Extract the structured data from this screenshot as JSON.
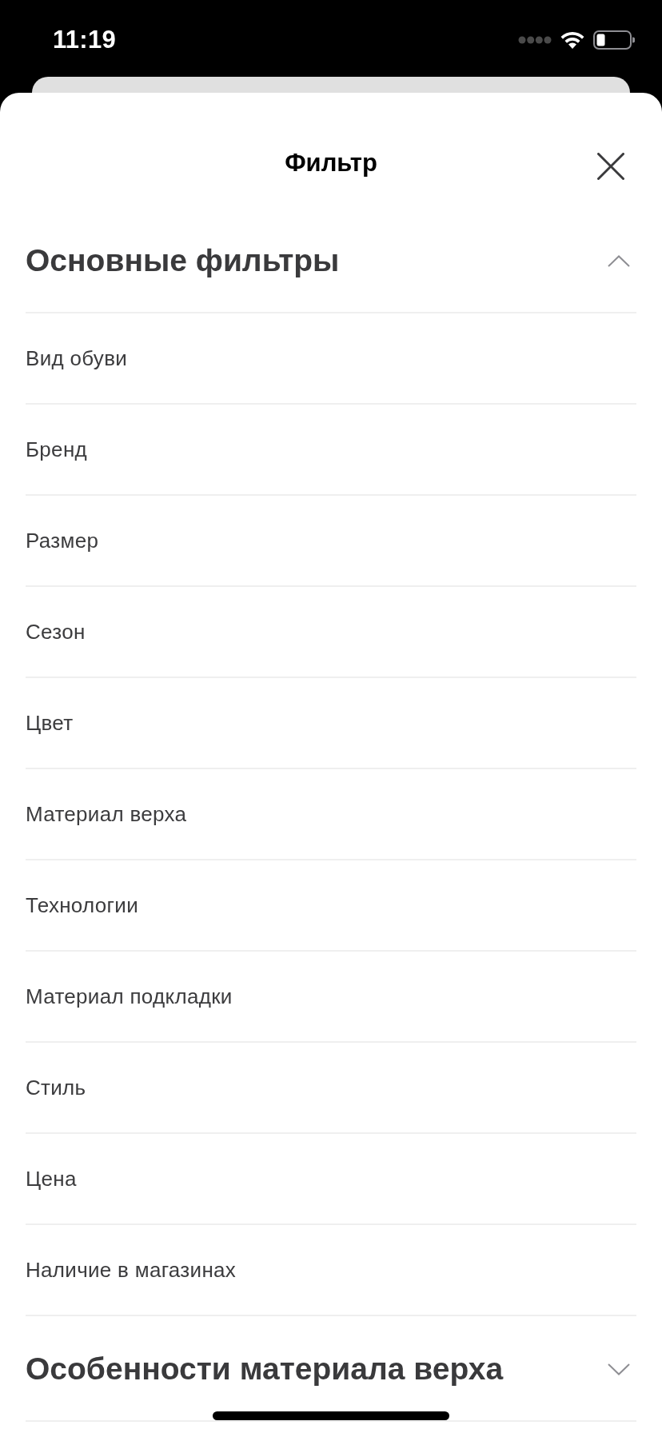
{
  "status_bar": {
    "time": "11:19"
  },
  "sheet": {
    "title": "Фильтр"
  },
  "sections": [
    {
      "title": "Основные фильтры",
      "expanded": true,
      "items": [
        "Вид обуви",
        "Бренд",
        "Размер",
        "Сезон",
        "Цвет",
        "Материал верха",
        "Технологии",
        "Материал подкладки",
        "Стиль",
        "Цена",
        "Наличие в магазинах"
      ]
    },
    {
      "title": "Особенности материала верха",
      "expanded": false
    }
  ]
}
